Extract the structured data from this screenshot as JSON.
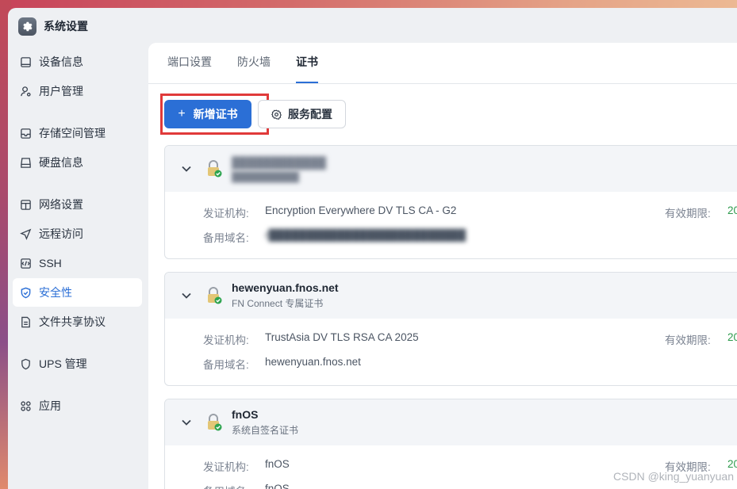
{
  "window": {
    "title": "系统设置",
    "icon": "gear-icon"
  },
  "sidebar": {
    "items": [
      {
        "label": "设备信息",
        "icon": "device-icon"
      },
      {
        "label": "用户管理",
        "icon": "user-icon"
      },
      {
        "label": "存储空间管理",
        "icon": "storage-icon"
      },
      {
        "label": "硬盘信息",
        "icon": "disk-icon"
      },
      {
        "label": "网络设置",
        "icon": "network-icon"
      },
      {
        "label": "远程访问",
        "icon": "remote-icon"
      },
      {
        "label": "SSH",
        "icon": "ssh-icon"
      },
      {
        "label": "安全性",
        "icon": "shield-icon",
        "active": true
      },
      {
        "label": "文件共享协议",
        "icon": "file-share-icon"
      },
      {
        "label": "UPS 管理",
        "icon": "ups-icon"
      },
      {
        "label": "应用",
        "icon": "apps-icon"
      }
    ]
  },
  "tabs": [
    {
      "label": "端口设置"
    },
    {
      "label": "防火墙"
    },
    {
      "label": "证书",
      "active": true
    }
  ],
  "toolbar": {
    "add_label": "新增证书",
    "add_icon": "+",
    "config_label": "服务配置"
  },
  "certs": [
    {
      "name": "████████████",
      "sub": "██████████",
      "issuer_label": "发证机构:",
      "issuer": "Encryption Everywhere DV TLS CA - G2",
      "alt_label": "备用域名:",
      "alt": "r██████████████████████████",
      "expiry_label": "有效期限:",
      "expiry": "20"
    },
    {
      "name": "hewenyuan.fnos.net",
      "sub": "FN Connect 专属证书",
      "issuer_label": "发证机构:",
      "issuer": "TrustAsia DV TLS RSA CA 2025",
      "alt_label": "备用域名:",
      "alt": "hewenyuan.fnos.net",
      "expiry_label": "有效期限:",
      "expiry": "20"
    },
    {
      "name": "fnOS",
      "sub": "系统自签名证书",
      "issuer_label": "发证机构:",
      "issuer": "fnOS",
      "alt_label": "备用域名:",
      "alt": "fnOS",
      "expiry_label": "有效期限:",
      "expiry": "20"
    }
  ],
  "watermark": "CSDN @king_yuanyuan",
  "colors": {
    "accent": "#2b6fd6",
    "highlight": "#e03a3a",
    "expiry": "#2e9a4d"
  }
}
